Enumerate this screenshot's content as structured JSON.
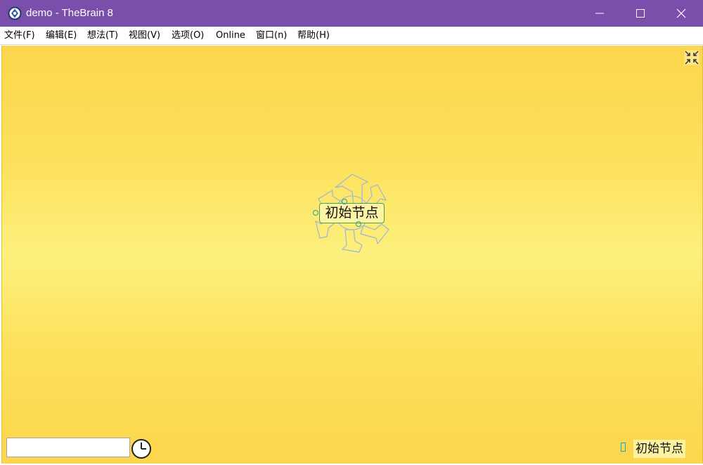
{
  "window": {
    "title": "demo - TheBrain 8",
    "app_icon": "thebrain-logo-icon",
    "buttons": [
      "minimize-icon",
      "maximize-icon",
      "close-icon"
    ],
    "titlebar_color": "#7a4fac"
  },
  "menubar": {
    "items": [
      {
        "label": "文件(F)"
      },
      {
        "label": "编辑(E)"
      },
      {
        "label": "想法(T)"
      },
      {
        "label": "视图(V)"
      },
      {
        "label": "选项(O)"
      },
      {
        "label": "Online"
      },
      {
        "label": "窗口(n)"
      },
      {
        "label": "帮助(H)"
      }
    ]
  },
  "plex": {
    "background_color": "#fde25f",
    "collapse_icon": "collapse-arrows-icon",
    "central_thought": {
      "label": "初始节点",
      "border_color": "#44a644",
      "wheel_icon": "thought-wheel-icon"
    }
  },
  "bottom_bar": {
    "search_value": "",
    "history_icon": "clock-icon",
    "active_thought_label": "初始节点"
  }
}
